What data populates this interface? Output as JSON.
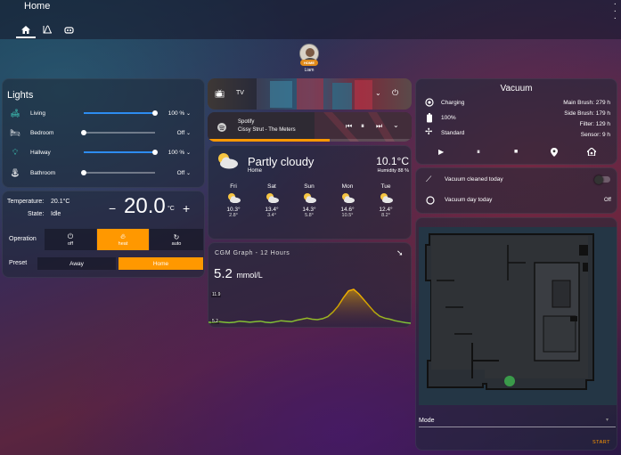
{
  "header": {
    "title": "Home",
    "tabs": [
      "home-icon",
      "history-icon",
      "robot-icon"
    ]
  },
  "person": {
    "badge": "HOME",
    "name": "Liam"
  },
  "lights": {
    "title": "Lights",
    "items": [
      {
        "label": "Living",
        "value": "100 %",
        "level": 1.0,
        "icon": "sofa-icon"
      },
      {
        "label": "Bedroom",
        "value": "Off",
        "level": 0.0,
        "icon": "bed-icon"
      },
      {
        "label": "Hallway",
        "value": "100 %",
        "level": 1.0,
        "icon": "ceiling-light-icon"
      },
      {
        "label": "Bathroom",
        "value": "Off",
        "level": 0.0,
        "icon": "lamp-icon"
      }
    ]
  },
  "thermostat": {
    "temperature_label": "Temperature:",
    "temperature": "20.1°C",
    "state_label": "State:",
    "state": "Idle",
    "setpoint": "20.0",
    "unit": "°C",
    "minus": "−",
    "plus": "+",
    "operation_label": "Operation",
    "modes": [
      {
        "label": "off",
        "icon": "power-icon"
      },
      {
        "label": "heat",
        "icon": "fire-icon"
      },
      {
        "label": "auto",
        "icon": "autorenew-icon"
      }
    ],
    "active_mode": "heat",
    "preset_label": "Preset",
    "presets": [
      "Away",
      "Home"
    ],
    "active_preset": "Home",
    "accent": "#ff9800"
  },
  "tv": {
    "label": "TV"
  },
  "spotify": {
    "source": "Spotify",
    "track": "Cissy Strut - The Meters",
    "progress": 0.6
  },
  "weather": {
    "condition": "Partly cloudy",
    "location": "Home",
    "temp": "10.1°C",
    "humidity": "Humidity 88 %",
    "forecast": [
      {
        "day": "Fri",
        "high": "10.3°",
        "low": "2.8°"
      },
      {
        "day": "Sat",
        "high": "13.4°",
        "low": "3.4°"
      },
      {
        "day": "Sun",
        "high": "14.3°",
        "low": "5.8°"
      },
      {
        "day": "Mon",
        "high": "14.6°",
        "low": "10.5°"
      },
      {
        "day": "Tue",
        "high": "12.4°",
        "low": "8.2°"
      }
    ]
  },
  "cgm": {
    "title": "CGM Graph - 12 Hours",
    "value": "5.2",
    "unit": "mmol/L",
    "max_label": "11.9",
    "min_label": "5.2"
  },
  "chart_data": {
    "type": "area",
    "title": "CGM Graph - 12 Hours",
    "ylim": [
      5.2,
      11.9
    ],
    "values": [
      5.4,
      5.3,
      5.5,
      5.4,
      5.3,
      5.4,
      5.6,
      5.5,
      5.4,
      5.5,
      5.6,
      5.4,
      5.3,
      5.5,
      5.7,
      5.6,
      5.5,
      5.8,
      6.0,
      6.2,
      6.0,
      5.9,
      6.1,
      6.5,
      7.4,
      8.6,
      10.2,
      11.6,
      11.9,
      11.0,
      9.8,
      8.6,
      7.4,
      6.6,
      6.2,
      6.0,
      5.7,
      5.5,
      5.3,
      5.2
    ]
  },
  "vacuum": {
    "title": "Vacuum",
    "status": "Charging",
    "battery": "100%",
    "fan": "Standard",
    "stats": [
      {
        "label": "Main Brush:",
        "value": "279 h"
      },
      {
        "label": "Side Brush:",
        "value": "179 h"
      },
      {
        "label": "Filter:",
        "value": "129 h"
      },
      {
        "label": "Sensor:",
        "value": "9 h"
      }
    ],
    "controls": [
      "play-icon",
      "pause-icon",
      "stop-icon",
      "map-marker-icon",
      "home-dock-icon"
    ]
  },
  "toggles": {
    "cleaned_label": "Vacuum cleaned today",
    "cleaned_state": false,
    "day_label": "Vacuum day today",
    "day_value": "Off"
  },
  "map_card": {
    "mode_label": "Mode",
    "start_label": "START"
  }
}
